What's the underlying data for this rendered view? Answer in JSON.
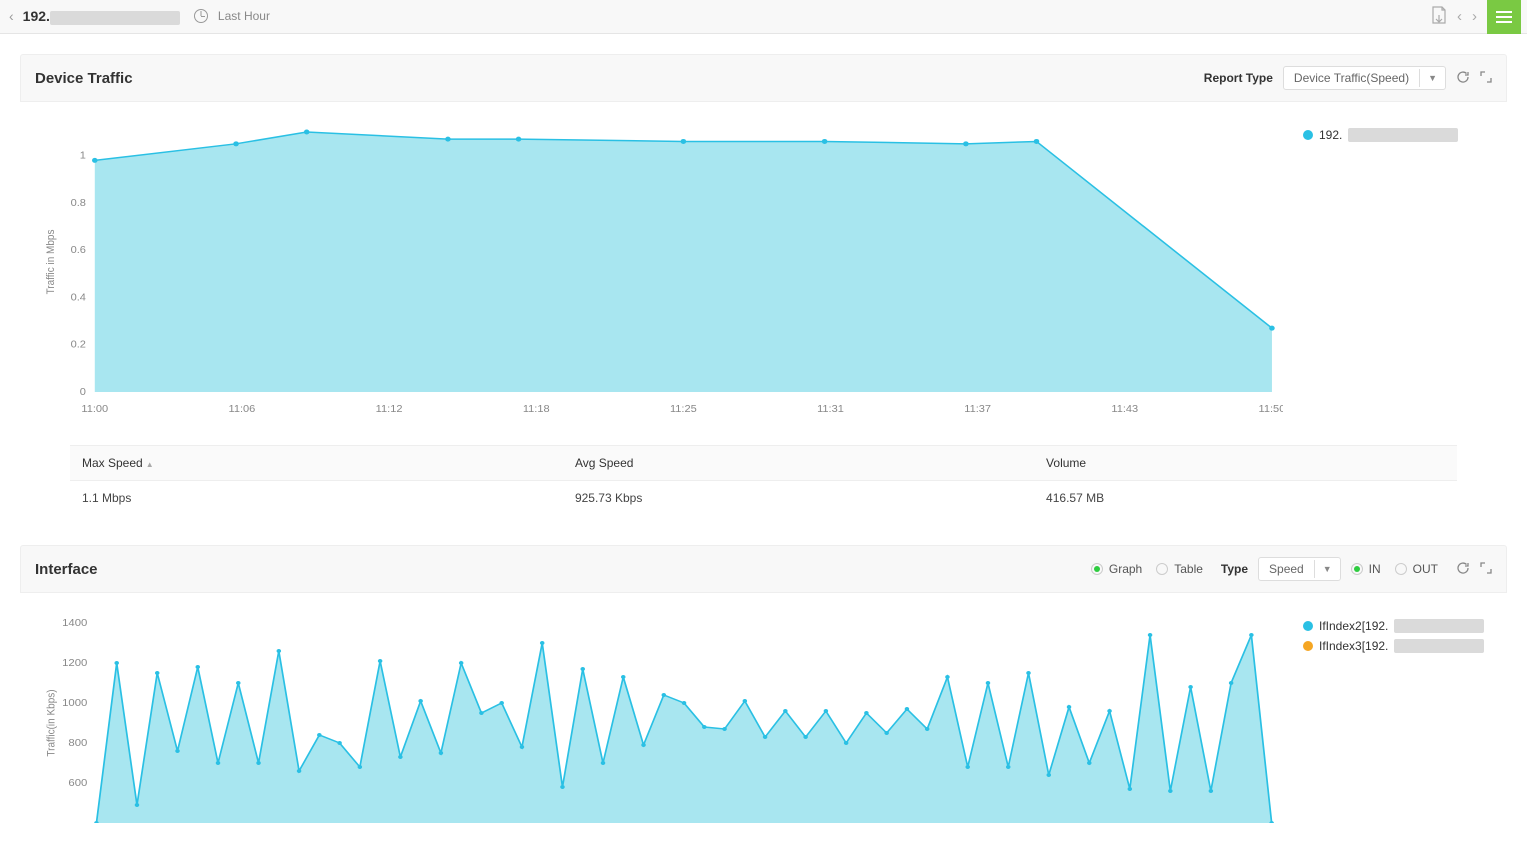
{
  "topbar": {
    "ip_prefix": "192.",
    "time_range": "Last Hour"
  },
  "panel1": {
    "title": "Device Traffic",
    "report_type_label": "Report Type",
    "report_type_value": "Device Traffic(Speed)"
  },
  "summary": {
    "col_max": "Max Speed",
    "col_avg": "Avg Speed",
    "col_vol": "Volume",
    "val_max": "1.1 Mbps",
    "val_avg": "925.73 Kbps",
    "val_vol": "416.57 MB"
  },
  "legend1": {
    "series1_prefix": "192."
  },
  "panel2": {
    "title": "Interface",
    "graph_label": "Graph",
    "table_label": "Table",
    "type_label": "Type",
    "type_value": "Speed",
    "in_label": "IN",
    "out_label": "OUT"
  },
  "legend2": {
    "series1_prefix": "IfIndex2[192.",
    "series2_prefix": "IfIndex3[192."
  },
  "chart_data": [
    {
      "type": "area",
      "title": "Device Traffic",
      "ylabel": "Traffic in Mbps",
      "xlabel": "",
      "ylim": [
        0,
        1.1
      ],
      "x_ticks": [
        "11:00",
        "11:06",
        "11:12",
        "11:18",
        "11:25",
        "11:31",
        "11:37",
        "11:43",
        "11:50"
      ],
      "y_ticks": [
        0,
        0.2,
        0.4,
        0.6,
        0.8,
        1
      ],
      "series": [
        {
          "name": "192.",
          "color": "#2ac0e4",
          "x": [
            "11:00",
            "11:06",
            "11:09",
            "11:15",
            "11:18",
            "11:25",
            "11:31",
            "11:37",
            "11:40",
            "11:50"
          ],
          "y": [
            0.98,
            1.05,
            1.1,
            1.07,
            1.07,
            1.06,
            1.06,
            1.05,
            1.06,
            0.27
          ]
        }
      ]
    },
    {
      "type": "area",
      "title": "Interface",
      "ylabel": "Traffic(in Kbps)",
      "xlabel": "",
      "ylim": [
        400,
        1400
      ],
      "y_ticks": [
        600,
        800,
        1000,
        1200,
        1400
      ],
      "series": [
        {
          "name": "IfIndex2[192.",
          "color": "#2ac0e4",
          "y": [
            400,
            1200,
            490,
            1150,
            760,
            1180,
            700,
            1100,
            700,
            1260,
            660,
            840,
            800,
            680,
            1210,
            730,
            1010,
            750,
            1200,
            950,
            1000,
            780,
            1300,
            580,
            1170,
            700,
            1130,
            790,
            1040,
            1000,
            880,
            870,
            1010,
            830,
            960,
            830,
            960,
            800,
            950,
            850,
            970,
            870,
            1130,
            680,
            1100,
            680,
            1150,
            640,
            980,
            700,
            960,
            570,
            1340,
            560,
            1080,
            560,
            1100,
            1340,
            400
          ]
        },
        {
          "name": "IfIndex3[192.",
          "color": "#f5a623",
          "y": []
        }
      ]
    }
  ]
}
